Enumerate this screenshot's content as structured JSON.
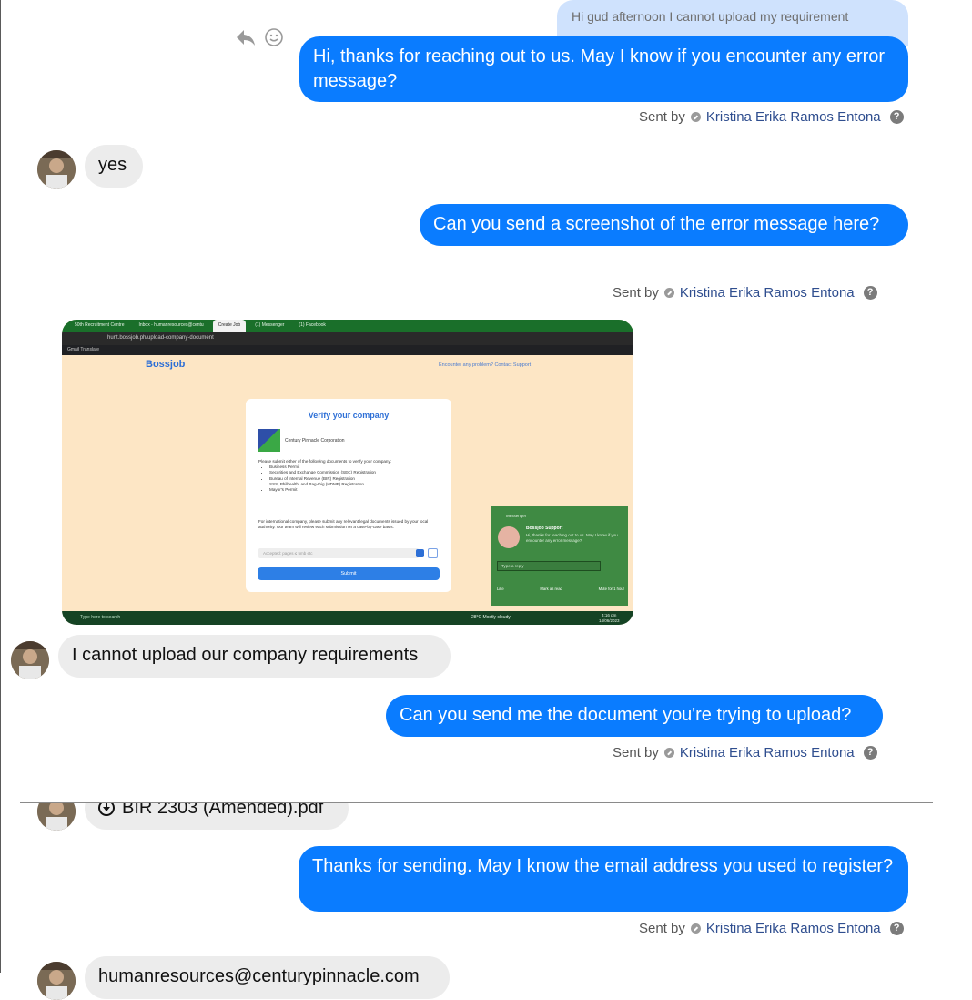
{
  "messages": {
    "quote_text": "Hi gud afternoon I cannot upload my requirement",
    "m1": "Hi, thanks for reaching out to us. May I know if you encounter any error message?",
    "m2": "yes",
    "m3": "Can you send a screenshot of the error message here?",
    "m4": "I cannot upload our company requirements",
    "m5": "Can you send me the document you're trying to upload?",
    "m6_file": "BIR 2303 (Amended).pdf",
    "m7": "Thanks for sending. May I know the email address you used to register?",
    "m8_partial": "humanresources@centurypinnacle.com"
  },
  "sent_by": {
    "prefix": "Sent by",
    "agent": "Kristina Erika Ramos Entona",
    "help": "?"
  },
  "icons": {
    "reply": "reply-icon",
    "react": "smiley-icon",
    "status": "check-circle-icon",
    "help": "help-icon",
    "download": "download-icon"
  },
  "colors": {
    "outgoing_bubble": "#0a7cff",
    "incoming_bubble": "#ececec",
    "quoted_bubble": "#cfe2fd",
    "agent_name": "#2f4e8f"
  },
  "screenshot": {
    "tabs": [
      "50th Recruitment Centre",
      "Inbox - humanresources@centu",
      "Create Job",
      "(1) Messenger",
      "(1) Facebook"
    ],
    "url": "hunt.bossjob.ph/upload-company-document",
    "bookmarks": "Gmail   Translate",
    "logo": "Bossjob",
    "support": "Encounter any problem? Contact Support",
    "card_title": "Verify your company",
    "company_name": "Century Pinnacle Corporation",
    "instructions_intro": "Please submit either of the following documents to verify your company:",
    "documents": [
      "Business Permit",
      "Securities and Exchange Commission (SEC) Registration",
      "Bureau of Internal Revenue (BIR) Registration",
      "SSS, Philhealth, and Pag-Ibig (HDMF) Registration",
      "Mayor's Permit"
    ],
    "intl_note": "For international company, please submit any relevant legal documents issued by your local authority. Our team will review each submission on a case-by-case basis.",
    "upload_placeholder": "Accepted: pages ≤ 5mb etc",
    "submit": "Submit",
    "messenger_title": "Messenger",
    "messenger_name": "Bossjob Support",
    "messenger_msg": "Hi, thanks for reaching out to us. May I know if you encounter any error message?",
    "messenger_reply": "Type a reply",
    "messenger_actions": [
      "Like",
      "Mark as read",
      "Mute for 1 hour"
    ],
    "taskbar_search": "Type here to search",
    "weather": "28°C  Mostly cloudy",
    "time": "4:16 pm",
    "date": "14/06/2023"
  }
}
